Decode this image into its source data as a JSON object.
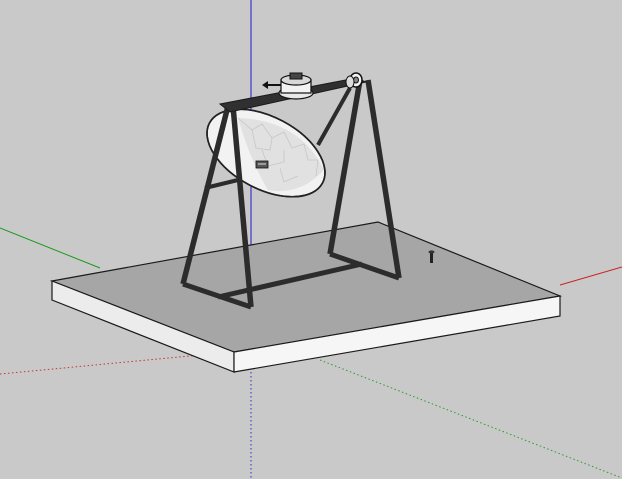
{
  "viewport": {
    "background": "#c9c9c9",
    "axis_colors": {
      "red": "#cc0000",
      "green": "#009900",
      "blue": "#0000cc"
    }
  },
  "model": {
    "components": [
      "base-platform",
      "a-frame-stand",
      "parabolic-dish",
      "drive-motor",
      "support-pulley",
      "small-bolt"
    ]
  }
}
